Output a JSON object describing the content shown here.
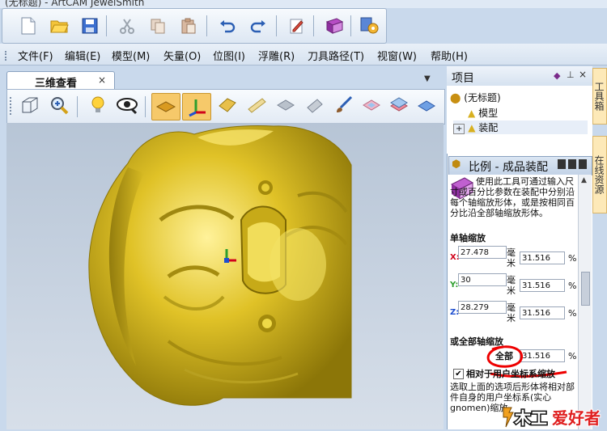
{
  "window": {
    "title_partial": "(无标题) - ArtCAM JewelSmith"
  },
  "toolbar": {
    "buttons": [
      "new-file",
      "open-folder",
      "save",
      "cut",
      "copy",
      "paste",
      "undo",
      "redo",
      "edit-note",
      "help-book",
      "settings-tools"
    ]
  },
  "menubar": {
    "items": [
      "文件(F)",
      "编辑(E)",
      "模型(M)",
      "矢量(O)",
      "位图(I)",
      "浮雕(R)",
      "刀具路径(T)",
      "视窗(W)",
      "帮助(H)"
    ]
  },
  "view": {
    "tab_label": "三维查看",
    "tab_close": "×"
  },
  "project_panel": {
    "title": "项目",
    "root": "(无标题)",
    "children": [
      "模型",
      "装配"
    ]
  },
  "scale_panel": {
    "title": "比例 - 成品装配",
    "description": "使用此工具可通过输入尺寸或百分比参数在装配中分别沿每个轴缩放形体，或是按相同百分比沿全部轴缩放形体。",
    "single_axis_heading": "单轴缩放",
    "axes": [
      {
        "axis": "X:",
        "value": "27.478",
        "unit": "毫米",
        "percent": "31.516",
        "pct_sign": "%",
        "color": "#d0021b"
      },
      {
        "axis": "Y:",
        "value": "30",
        "unit": "毫米",
        "percent": "31.516",
        "pct_sign": "%",
        "color": "#2e9e2e"
      },
      {
        "axis": "Z:",
        "value": "28.279",
        "unit": "毫米",
        "percent": "31.516",
        "pct_sign": "%",
        "color": "#1f4fd0"
      }
    ],
    "all_axis_heading": "或全部轴缩放",
    "all_label": "全部",
    "all_percent": "31.516",
    "all_pct_sign": "%",
    "relative_checkbox_label": "相对于用户坐标系缩放",
    "relative_checked": true,
    "footer_text": "选取上面的选项后形体将相对部件自身的用户坐标系(实心gnomen)缩放"
  },
  "side_tabs": [
    "工具箱",
    "在线资源"
  ],
  "watermark": {
    "text": "爱好者",
    "prefix": "木工"
  }
}
